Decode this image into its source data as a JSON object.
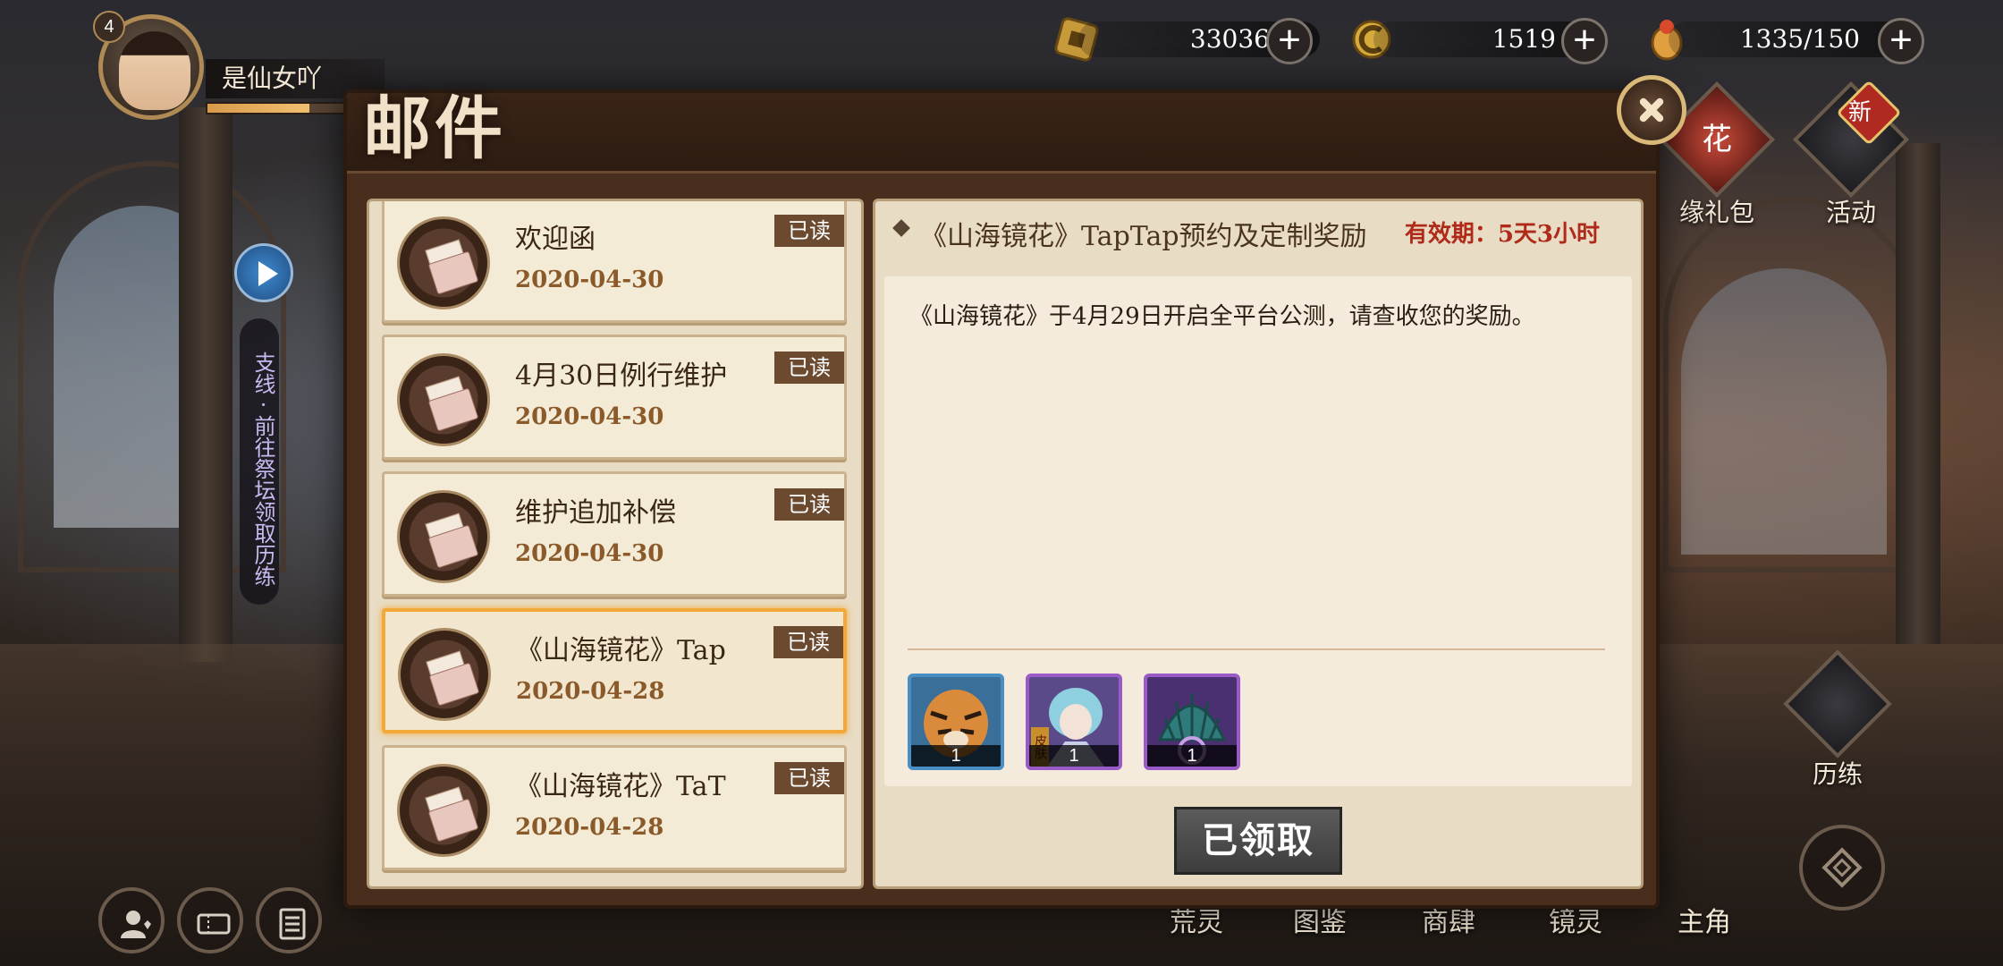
{
  "player": {
    "level": "4",
    "name": "是仙女吖"
  },
  "currencies": [
    {
      "icon": "coin-icon",
      "value": "33036"
    },
    {
      "icon": "gold-c-icon",
      "value": "1519"
    },
    {
      "icon": "stamina-icon",
      "value": "1335/150"
    }
  ],
  "side_menu": {
    "gift_label": "缘礼包",
    "activity_label": "活动",
    "activity_badge": "新",
    "train_label": "历练",
    "gift_tile_text": "花"
  },
  "bottom_nav": {
    "items": [
      "荒灵",
      "图鉴",
      "商肆",
      "镜灵",
      "主角"
    ]
  },
  "quest": {
    "text": "支线 · 前往祭坛领取历练"
  },
  "mail_dialog": {
    "title": "邮件",
    "mails": [
      {
        "title": "欢迎函",
        "date": "2020-04-30",
        "status": "已读"
      },
      {
        "title": "4月30日例行维护",
        "date": "2020-04-30",
        "status": "已读"
      },
      {
        "title": "维护追加补偿",
        "date": "2020-04-30",
        "status": "已读"
      },
      {
        "title": "《山海镜花》Tap",
        "date": "2020-04-28",
        "status": "已读"
      },
      {
        "title": "《山海镜花》TaT",
        "date": "2020-04-28",
        "status": "已读"
      }
    ],
    "detail": {
      "subject": "《山海镜花》TapTap预约及定制奖励",
      "expiry": "有效期：5天3小时",
      "body": "《山海镜花》于4月29日开启全平台公测，请查收您的奖励。",
      "rewards": [
        {
          "icon": "tiger-portrait-icon",
          "qty": "1",
          "rarity": "blue"
        },
        {
          "icon": "skin-portrait-icon",
          "qty": "1",
          "rarity": "purple",
          "tag": "皮肤"
        },
        {
          "icon": "shell-frame-icon",
          "qty": "1",
          "rarity": "purple"
        }
      ],
      "claim_button": "已领取"
    }
  },
  "colors": {
    "accent": "#f3a93a",
    "panel": "#e8dcc4",
    "expiry": "#b02a1a",
    "dialog_frame": "#4a2e1d"
  }
}
